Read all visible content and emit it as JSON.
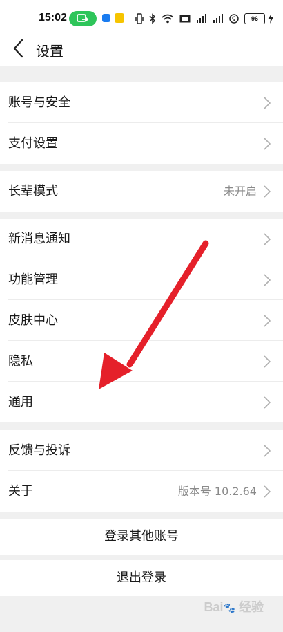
{
  "status_bar": {
    "time": "15:02",
    "battery": "96",
    "icons": [
      "vibrate-icon",
      "bluetooth-icon",
      "wifi-icon",
      "hd-icon",
      "signal-1-icon",
      "signal-2-icon",
      "data-saver-icon",
      "battery-icon",
      "charging-icon"
    ]
  },
  "header": {
    "title": "设置"
  },
  "sections": [
    {
      "items": [
        {
          "label": "账号与安全",
          "value": ""
        },
        {
          "label": "支付设置",
          "value": ""
        }
      ]
    },
    {
      "items": [
        {
          "label": "长辈模式",
          "value": "未开启"
        }
      ]
    },
    {
      "items": [
        {
          "label": "新消息通知",
          "value": ""
        },
        {
          "label": "功能管理",
          "value": ""
        },
        {
          "label": "皮肤中心",
          "value": ""
        },
        {
          "label": "隐私",
          "value": ""
        },
        {
          "label": "通用",
          "value": ""
        }
      ]
    },
    {
      "items": [
        {
          "label": "反馈与投诉",
          "value": ""
        },
        {
          "label": "关于",
          "value": "版本号 10.2.64"
        }
      ]
    }
  ],
  "buttons": {
    "switch_account": "登录其他账号",
    "logout": "退出登录"
  },
  "watermark": "Bai 经验",
  "colors": {
    "arrow": "#e5202a",
    "pill": "#2ec55a",
    "background": "#f0f0f0"
  }
}
